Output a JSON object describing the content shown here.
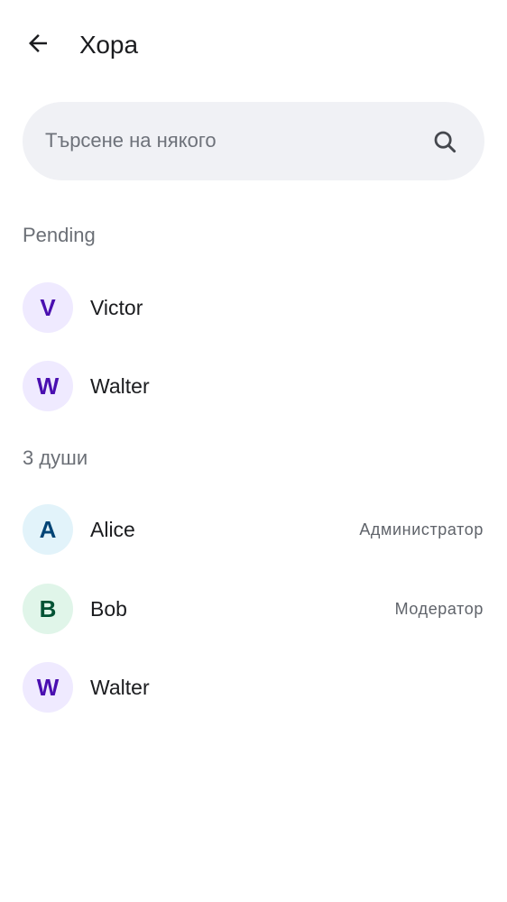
{
  "header": {
    "back_icon": "arrow-left-icon",
    "title": "Хора"
  },
  "search": {
    "placeholder": "Търсене на някого",
    "value": "",
    "icon": "search-icon"
  },
  "sections": {
    "pending": {
      "title": "Pending",
      "members": [
        {
          "initial": "V",
          "name": "Victor",
          "role": "",
          "avatar_bg": "#efeaff",
          "avatar_fg": "#4a0fb0"
        },
        {
          "initial": "W",
          "name": "Walter",
          "role": "",
          "avatar_bg": "#efeaff",
          "avatar_fg": "#4a0fb0"
        }
      ]
    },
    "joined": {
      "title": "3 души",
      "members": [
        {
          "initial": "A",
          "name": "Alice",
          "role": "Администратор",
          "avatar_bg": "#e2f3fa",
          "avatar_fg": "#004475"
        },
        {
          "initial": "B",
          "name": "Bob",
          "role": "Модератор",
          "avatar_bg": "#e0f5e9",
          "avatar_fg": "#005234"
        },
        {
          "initial": "W",
          "name": "Walter",
          "role": "",
          "avatar_bg": "#efeaff",
          "avatar_fg": "#4a0fb0"
        }
      ]
    }
  },
  "colors": {
    "background": "#ffffff",
    "search_bg": "#f0f1f5",
    "section_text": "#6b6f76",
    "primary_text": "#1b1c1f",
    "secondary_text": "#5f636a"
  }
}
